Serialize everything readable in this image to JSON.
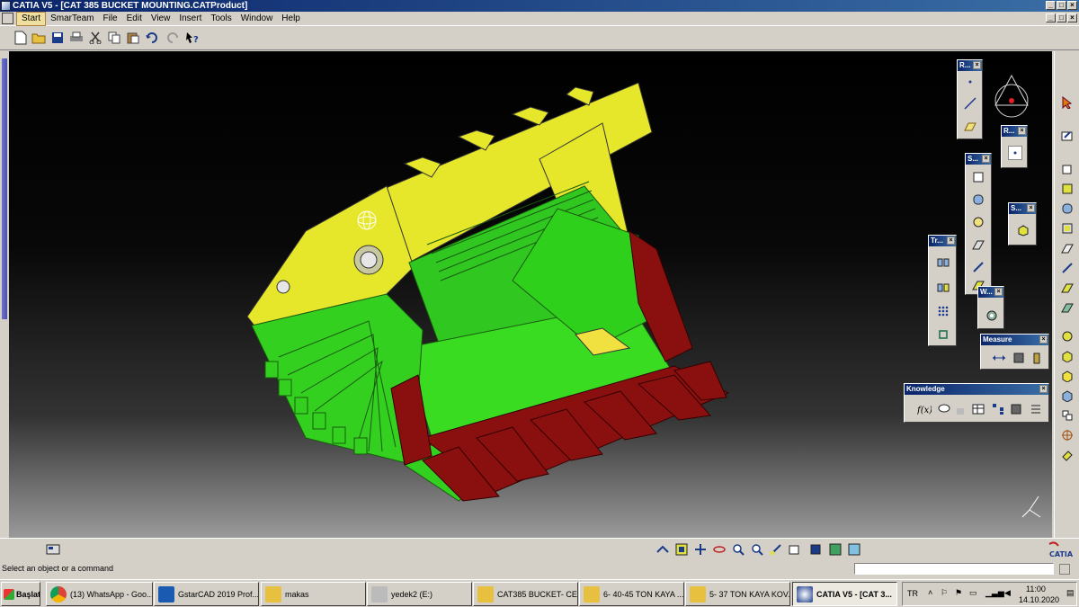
{
  "window": {
    "title": "CATIA V5 - [CAT 385 BUCKET MOUNTING.CATProduct]",
    "btn_min": "_",
    "btn_max": "□",
    "btn_close": "×"
  },
  "menu": {
    "items": [
      "Start",
      "SmarTeam",
      "File",
      "Edit",
      "View",
      "Insert",
      "Tools",
      "Window",
      "Help"
    ]
  },
  "toolbars": {
    "r1_title": "R...",
    "r2_title": "R...",
    "s1_title": "S...",
    "s2_title": "S...",
    "tr_title": "Tr...",
    "w_title": "W...",
    "measure_title": "Measure",
    "knowledge_title": "Knowledge",
    "close": "×"
  },
  "status": {
    "prompt": "Select an object or a command"
  },
  "taskbar": {
    "start": "Başlat",
    "tasks": [
      "(13) WhatsApp - Goo...",
      "GstarCAD 2019 Prof...",
      "makas",
      "yedek2 (E:)",
      "CAT385 BUCKET- CE...",
      "6- 40-45 TON KAYA ...",
      "5- 37 TON KAYA KOV...",
      "CATIA V5 - [CAT 3..."
    ],
    "lang": "TR",
    "time": "11:00",
    "date": "14.10.2020"
  },
  "brand": {
    "logo_text": "CATIA"
  },
  "colors": {
    "bucket_green": "#2ecc1a",
    "bucket_yellow": "#e0e020",
    "teeth_red": "#8a1010",
    "title_blue": "#0a246a"
  }
}
